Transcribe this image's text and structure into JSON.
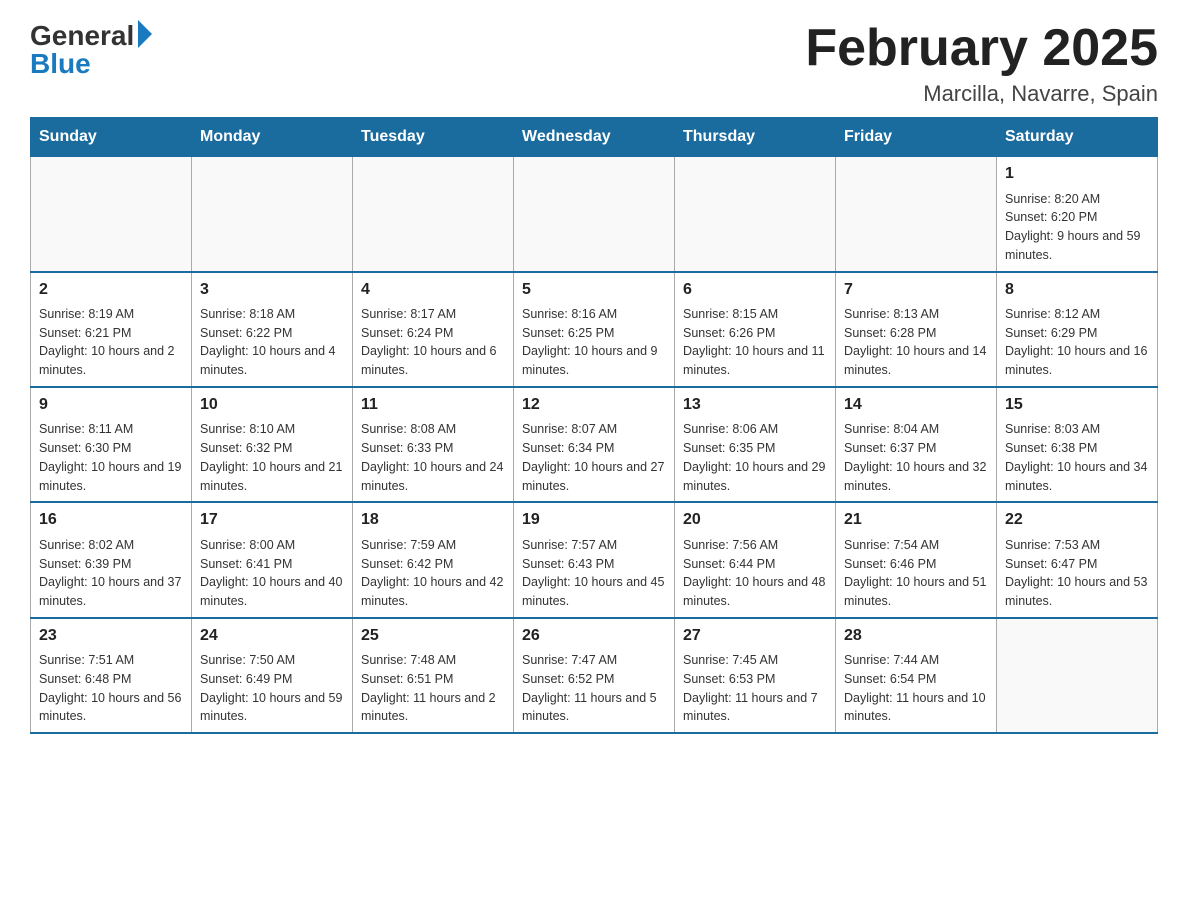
{
  "header": {
    "logo_general": "General",
    "logo_blue": "Blue",
    "title": "February 2025",
    "location": "Marcilla, Navarre, Spain"
  },
  "days_of_week": [
    "Sunday",
    "Monday",
    "Tuesday",
    "Wednesday",
    "Thursday",
    "Friday",
    "Saturday"
  ],
  "weeks": [
    [
      {
        "day": "",
        "info": ""
      },
      {
        "day": "",
        "info": ""
      },
      {
        "day": "",
        "info": ""
      },
      {
        "day": "",
        "info": ""
      },
      {
        "day": "",
        "info": ""
      },
      {
        "day": "",
        "info": ""
      },
      {
        "day": "1",
        "info": "Sunrise: 8:20 AM\nSunset: 6:20 PM\nDaylight: 9 hours and 59 minutes."
      }
    ],
    [
      {
        "day": "2",
        "info": "Sunrise: 8:19 AM\nSunset: 6:21 PM\nDaylight: 10 hours and 2 minutes."
      },
      {
        "day": "3",
        "info": "Sunrise: 8:18 AM\nSunset: 6:22 PM\nDaylight: 10 hours and 4 minutes."
      },
      {
        "day": "4",
        "info": "Sunrise: 8:17 AM\nSunset: 6:24 PM\nDaylight: 10 hours and 6 minutes."
      },
      {
        "day": "5",
        "info": "Sunrise: 8:16 AM\nSunset: 6:25 PM\nDaylight: 10 hours and 9 minutes."
      },
      {
        "day": "6",
        "info": "Sunrise: 8:15 AM\nSunset: 6:26 PM\nDaylight: 10 hours and 11 minutes."
      },
      {
        "day": "7",
        "info": "Sunrise: 8:13 AM\nSunset: 6:28 PM\nDaylight: 10 hours and 14 minutes."
      },
      {
        "day": "8",
        "info": "Sunrise: 8:12 AM\nSunset: 6:29 PM\nDaylight: 10 hours and 16 minutes."
      }
    ],
    [
      {
        "day": "9",
        "info": "Sunrise: 8:11 AM\nSunset: 6:30 PM\nDaylight: 10 hours and 19 minutes."
      },
      {
        "day": "10",
        "info": "Sunrise: 8:10 AM\nSunset: 6:32 PM\nDaylight: 10 hours and 21 minutes."
      },
      {
        "day": "11",
        "info": "Sunrise: 8:08 AM\nSunset: 6:33 PM\nDaylight: 10 hours and 24 minutes."
      },
      {
        "day": "12",
        "info": "Sunrise: 8:07 AM\nSunset: 6:34 PM\nDaylight: 10 hours and 27 minutes."
      },
      {
        "day": "13",
        "info": "Sunrise: 8:06 AM\nSunset: 6:35 PM\nDaylight: 10 hours and 29 minutes."
      },
      {
        "day": "14",
        "info": "Sunrise: 8:04 AM\nSunset: 6:37 PM\nDaylight: 10 hours and 32 minutes."
      },
      {
        "day": "15",
        "info": "Sunrise: 8:03 AM\nSunset: 6:38 PM\nDaylight: 10 hours and 34 minutes."
      }
    ],
    [
      {
        "day": "16",
        "info": "Sunrise: 8:02 AM\nSunset: 6:39 PM\nDaylight: 10 hours and 37 minutes."
      },
      {
        "day": "17",
        "info": "Sunrise: 8:00 AM\nSunset: 6:41 PM\nDaylight: 10 hours and 40 minutes."
      },
      {
        "day": "18",
        "info": "Sunrise: 7:59 AM\nSunset: 6:42 PM\nDaylight: 10 hours and 42 minutes."
      },
      {
        "day": "19",
        "info": "Sunrise: 7:57 AM\nSunset: 6:43 PM\nDaylight: 10 hours and 45 minutes."
      },
      {
        "day": "20",
        "info": "Sunrise: 7:56 AM\nSunset: 6:44 PM\nDaylight: 10 hours and 48 minutes."
      },
      {
        "day": "21",
        "info": "Sunrise: 7:54 AM\nSunset: 6:46 PM\nDaylight: 10 hours and 51 minutes."
      },
      {
        "day": "22",
        "info": "Sunrise: 7:53 AM\nSunset: 6:47 PM\nDaylight: 10 hours and 53 minutes."
      }
    ],
    [
      {
        "day": "23",
        "info": "Sunrise: 7:51 AM\nSunset: 6:48 PM\nDaylight: 10 hours and 56 minutes."
      },
      {
        "day": "24",
        "info": "Sunrise: 7:50 AM\nSunset: 6:49 PM\nDaylight: 10 hours and 59 minutes."
      },
      {
        "day": "25",
        "info": "Sunrise: 7:48 AM\nSunset: 6:51 PM\nDaylight: 11 hours and 2 minutes."
      },
      {
        "day": "26",
        "info": "Sunrise: 7:47 AM\nSunset: 6:52 PM\nDaylight: 11 hours and 5 minutes."
      },
      {
        "day": "27",
        "info": "Sunrise: 7:45 AM\nSunset: 6:53 PM\nDaylight: 11 hours and 7 minutes."
      },
      {
        "day": "28",
        "info": "Sunrise: 7:44 AM\nSunset: 6:54 PM\nDaylight: 11 hours and 10 minutes."
      },
      {
        "day": "",
        "info": ""
      }
    ]
  ]
}
